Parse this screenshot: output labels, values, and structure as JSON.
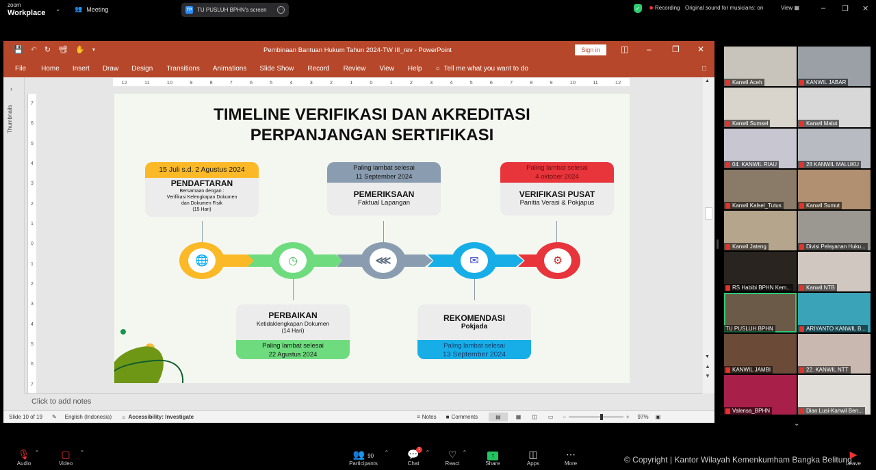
{
  "zoom_top": {
    "brand_small": "zoom",
    "brand_main": "Workplace",
    "meeting_label": "Meeting",
    "screen_share_label": "TU PUSLUH BPHN's screen",
    "screen_share_initials": "TP",
    "recording_label": "Recording",
    "original_sound": "Original sound for musicians: on",
    "view_label": "View"
  },
  "ppt": {
    "doc_title": "Pembinaan Bantuan Hukum Tahun 2024-TW III_rev  -  PowerPoint",
    "sign_in": "Sign in",
    "ribbon_tabs": [
      "File",
      "Home",
      "Insert",
      "Draw",
      "Design",
      "Transitions",
      "Animations",
      "Slide Show",
      "Record",
      "Review",
      "View",
      "Help"
    ],
    "tell_me": "Tell me what you want to do",
    "thumbnails_label": "Thumbnails",
    "hruler_ticks": [
      "12",
      "11",
      "10",
      "9",
      "8",
      "7",
      "6",
      "5",
      "4",
      "3",
      "2",
      "1",
      "0",
      "1",
      "2",
      "3",
      "4",
      "5",
      "6",
      "7",
      "8",
      "9",
      "10",
      "11",
      "12"
    ],
    "vruler_ticks": [
      "7",
      "6",
      "5",
      "4",
      "3",
      "2",
      "1",
      "0",
      "1",
      "2",
      "3",
      "4",
      "5",
      "6",
      "7"
    ],
    "notes_placeholder": "Click to add notes",
    "status": {
      "slide": "Slide 10 of 19",
      "language": "English (Indonesia)",
      "accessibility": "Accessibility: Investigate",
      "notes": "Notes",
      "comments": "Comments",
      "zoom_percent": "97%",
      "zoom_value": 0.6
    }
  },
  "slide": {
    "title_line1": "TIMELINE VERIFIKASI DAN AKREDITASI",
    "title_line2": "PERPANJANGAN SERTIFIKASI",
    "steps": [
      {
        "head": "15 Juli s.d. 2 Agustus 2024",
        "title": "PENDAFTARAN",
        "lines": [
          "Bersamaan dengan :",
          "Verifikasi Kelengkapan Dokumen",
          "dan Dokumen Fisik",
          "(15 Hari)"
        ],
        "color": "#fbb927",
        "icon": "globe-icon"
      },
      {
        "head": "Paling lambat selesai 22 Agustus 2024",
        "head1": "Paling lambat selesai",
        "head2": "22 Agustus 2024",
        "title": "PERBAIKAN",
        "lines": [
          "Ketidaklengkapan Dokumen",
          "(14 Hari)"
        ],
        "color": "#6edc7e",
        "icon": "clock-icon"
      },
      {
        "head1": "Paling lambat selesai",
        "head2": "11 September 2024",
        "title": "PEMERIKSAAN",
        "lines": [
          "Faktual Lapangan"
        ],
        "color": "#8a9db0",
        "icon": "share-icon"
      },
      {
        "head1": "Paling lambat selesai",
        "head2": "13 September 2024",
        "title": "REKOMENDASI",
        "lines": [
          "Pokjada"
        ],
        "color": "#17aee8",
        "icon": "mail-icon"
      },
      {
        "head1": "Paling lambat selesai",
        "head2": "4 oktober 2024",
        "title": "VERIFIKASI PUSAT",
        "lines": [
          "Panitia Verasi & Pokjapus"
        ],
        "color": "#e8343b",
        "icon": "gears-icon"
      }
    ]
  },
  "gallery": [
    "Kanwil Aceh",
    "KANWIL JABAR",
    "Kanwil Sumsel",
    "Kanwil Malut",
    "04. KANWIL RIAU",
    "28 KANWIL MALUKU",
    "Kanwil Kalsel_Tutus",
    "Kanwil Sumut",
    "Kanwil Jateng",
    "Divisi Pelayanan Huku...",
    "RS Habibi BPHN Kem...",
    "Kanwil NTB",
    "TU PUSLUH BPHN",
    "ARIYANTO KANWIL B...",
    "KANWIL JAMBI",
    "22. KANWIL NTT",
    "Valensa_BPHN",
    "Dian Lusi-Kanwil Ben..."
  ],
  "zoom_bottom": {
    "audio": "Audio",
    "video": "Video",
    "participants": "Participants",
    "participants_count": "90",
    "chat": "Chat",
    "chat_badge": "1",
    "react": "React",
    "share": "Share",
    "apps": "Apps",
    "more": "More",
    "leave": "Leave",
    "copyright": "© Copyright | Kantor Wilayah Kemenkumham Bangka Belitung"
  }
}
